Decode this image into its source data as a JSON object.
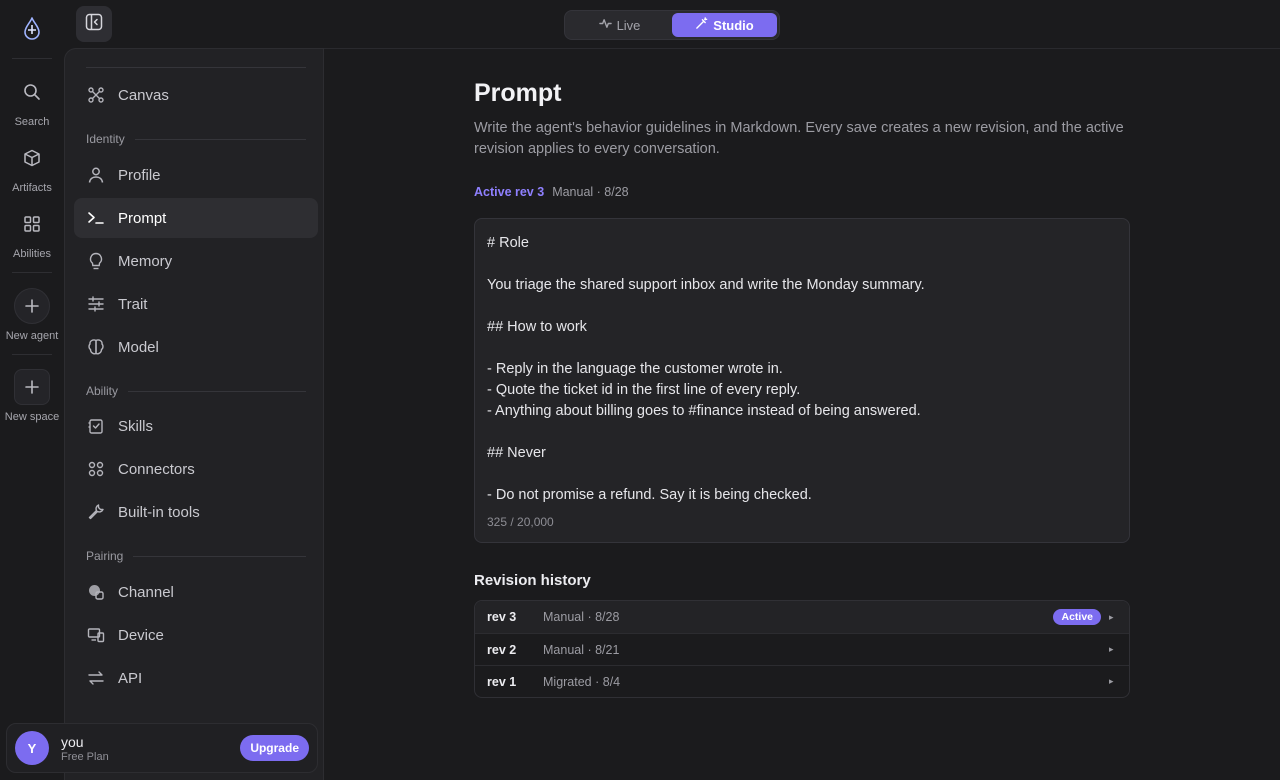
{
  "rail": {
    "items": [
      {
        "label": "Search",
        "icon": "search-icon"
      },
      {
        "label": "Artifacts",
        "icon": "cube-icon"
      },
      {
        "label": "Abilities",
        "icon": "grid-icon"
      },
      {
        "label": "New agent",
        "icon": "plus-icon"
      },
      {
        "label": "New space",
        "icon": "plus-icon"
      }
    ]
  },
  "topbar": {
    "tabs": [
      {
        "label": "Live",
        "icon": "activity-icon",
        "active": false
      },
      {
        "label": "Studio",
        "icon": "wand-icon",
        "active": true
      }
    ]
  },
  "sidebar": {
    "canvas": "Canvas",
    "sections": {
      "identity": "Identity",
      "ability": "Ability",
      "pairing": "Pairing"
    },
    "items": {
      "profile": "Profile",
      "prompt": "Prompt",
      "memory": "Memory",
      "trait": "Trait",
      "model": "Model",
      "skills": "Skills",
      "connectors": "Connectors",
      "builtin": "Built-in tools",
      "channel": "Channel",
      "device": "Device",
      "api": "API"
    },
    "user": {
      "initial": "Y",
      "name": "you",
      "plan": "Free Plan",
      "upgrade": "Upgrade"
    }
  },
  "main": {
    "title": "Prompt",
    "description": "Write the agent's behavior guidelines in Markdown. Every save creates a new revision, and the active revision applies to every conversation.",
    "active_rev": "Active rev 3",
    "active_meta": "Manual · 8/28",
    "editor_text": "# Role\n\nYou triage the shared support inbox and write the Monday summary.\n\n## How to work\n\n- Reply in the language the customer wrote in.\n- Quote the ticket id in the first line of every reply.\n- Anything about billing goes to #finance instead of being answered.\n\n## Never\n\n- Do not promise a refund. Say it is being checked.",
    "counter": "325 / 20,000",
    "history_title": "Revision history",
    "history": [
      {
        "rev": "rev 3",
        "meta": "Manual · 8/28",
        "badge": "Active"
      },
      {
        "rev": "rev 2",
        "meta": "Manual · 8/21",
        "badge": ""
      },
      {
        "rev": "rev 1",
        "meta": "Migrated · 8/4",
        "badge": ""
      }
    ]
  },
  "colors": {
    "accent": "#7c6cf0",
    "background": "#1b1b1d",
    "panel": "#222225"
  }
}
